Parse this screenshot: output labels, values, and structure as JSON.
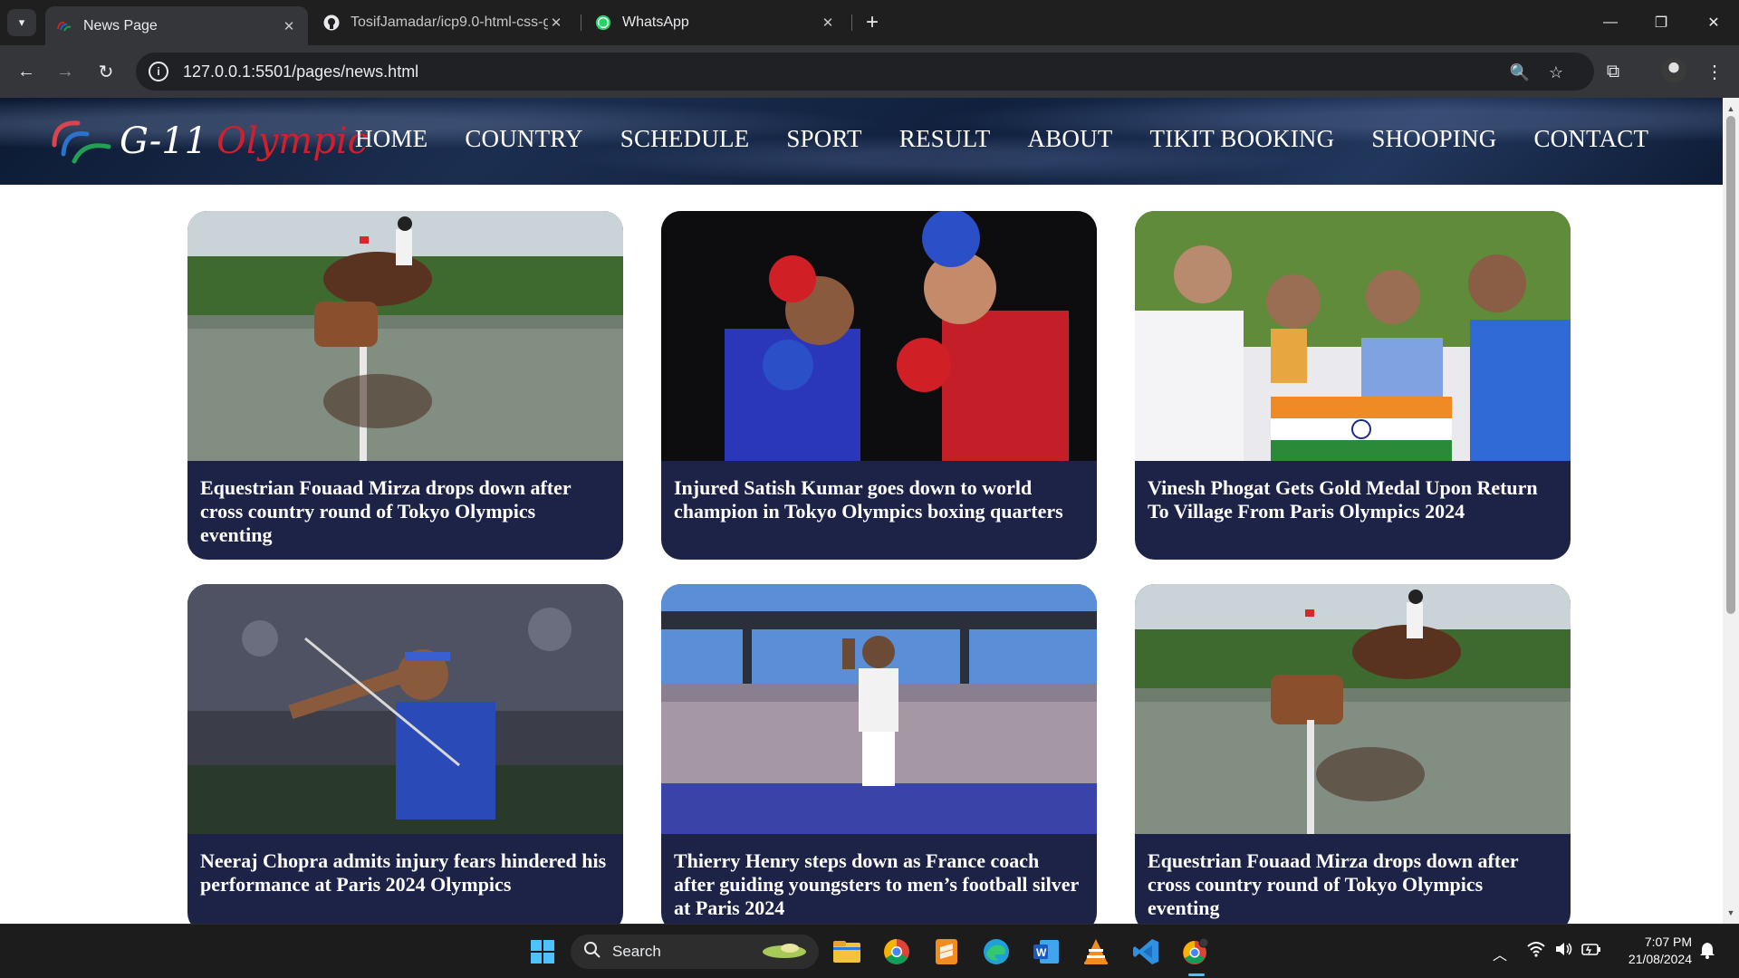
{
  "browser": {
    "tabs": [
      {
        "title": "News Page",
        "active": true
      },
      {
        "title": "TosifJamadar/icp9.0-html-css-g",
        "active": false
      },
      {
        "title": "WhatsApp",
        "active": false
      }
    ],
    "url": "127.0.0.1:5501/pages/news.html",
    "new_tab_label": "+"
  },
  "site": {
    "logo_prefix": "G-11",
    "logo_suffix": "Olympic",
    "nav": [
      "HOME",
      "COUNTRY",
      "SCHEDULE",
      "SPORT",
      "RESULT",
      "ABOUT",
      "TIKIT BOOKING",
      "SHOOPING",
      "CONTACT"
    ]
  },
  "articles": [
    {
      "headline": "Equestrian Fouaad Mirza drops down after cross country round of Tokyo Olympics eventing",
      "image": "equestrian-horse-water-jump"
    },
    {
      "headline": "Injured Satish Kumar goes down to world champion in Tokyo Olympics boxing quarters",
      "image": "boxing-match"
    },
    {
      "headline": "Vinesh Phogat Gets Gold Medal Upon Return To Village From Paris Olympics 2024",
      "image": "celebration-indian-flag"
    },
    {
      "headline": "Neeraj Chopra admits injury fears hindered his performance at Paris 2024 Olympics",
      "image": "javelin-thrower"
    },
    {
      "headline": "Thierry Henry steps down as France coach after guiding youngsters to men’s football silver at Paris 2024",
      "image": "stadium-crowd-waving"
    },
    {
      "headline": "Equestrian Fouaad Mirza drops down after cross country round of Tokyo Olympics eventing",
      "image": "equestrian-horse-water-jump"
    }
  ],
  "taskbar": {
    "search_label": "Search",
    "time": "7:07 PM",
    "date": "21/08/2024"
  },
  "colors": {
    "card_bg": "#1d2247",
    "logo_red": "#d21f2b",
    "header_dark": "#10203d",
    "chrome_dark": "#1f1f1f"
  }
}
